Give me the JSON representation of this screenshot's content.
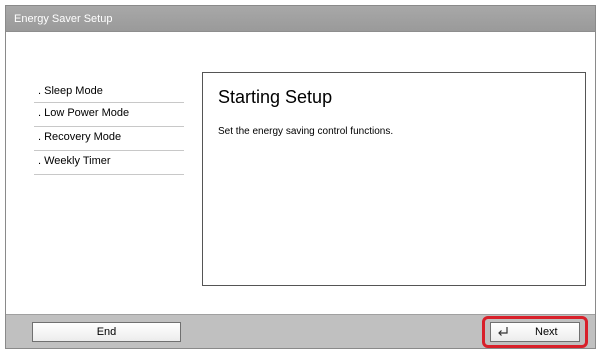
{
  "window": {
    "title": "Energy Saver Setup"
  },
  "steps": [
    {
      "label": ". Sleep Mode"
    },
    {
      "label": ". Low Power Mode"
    },
    {
      "label": ". Recovery Mode"
    },
    {
      "label": ". Weekly Timer"
    }
  ],
  "content": {
    "heading": "Starting Setup",
    "description": "Set the energy saving control functions."
  },
  "footer": {
    "end_label": "End",
    "next_label": "Next",
    "next_icon": "enter-return-icon",
    "highlight_color": "#d8202a"
  }
}
